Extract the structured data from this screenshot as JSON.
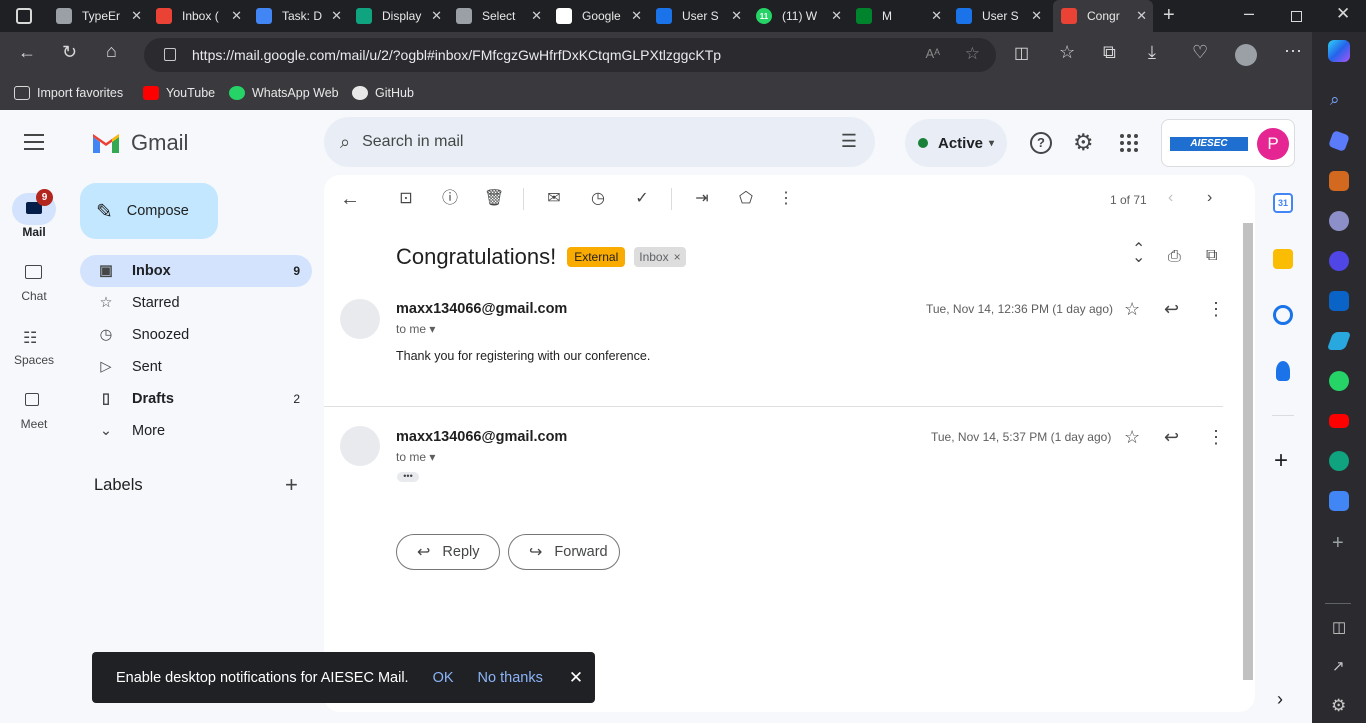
{
  "browser": {
    "tabs": [
      {
        "title": "TypeEr",
        "favicon": "doc-icon",
        "color": "#9aa0a6"
      },
      {
        "title": "Inbox (",
        "favicon": "gmail-icon",
        "color": "#ea4335"
      },
      {
        "title": "Task: D",
        "favicon": "docs-icon",
        "color": "#4285f4"
      },
      {
        "title": "Display",
        "favicon": "chatgpt-icon",
        "color": "#10a37f"
      },
      {
        "title": "Select ",
        "favicon": "doc-icon",
        "color": "#9aa0a6"
      },
      {
        "title": "Google",
        "favicon": "google-icon",
        "color": "#ffffff"
      },
      {
        "title": "User S",
        "favicon": "user-s-icon",
        "color": "#1a73e8"
      },
      {
        "title": "(11) W",
        "favicon": "whatsapp-icon",
        "color": "#25d366"
      },
      {
        "title": "M",
        "favicon": "meet-icon",
        "color": "#00832d"
      },
      {
        "title": "User S",
        "favicon": "user-s-icon",
        "color": "#1a73e8"
      },
      {
        "title": "Congr",
        "favicon": "gmail-icon",
        "color": "#ea4335"
      }
    ],
    "url": "https://mail.google.com/mail/u/2/?ogbl#inbox/FMfcgzGwHfrfDxKCtqmGLPXtlzggcKTp",
    "bookmarks": [
      {
        "label": "Import favorites",
        "icon": "import-icon"
      },
      {
        "label": "YouTube",
        "icon": "youtube-icon"
      },
      {
        "label": "WhatsApp Web",
        "icon": "whatsapp-icon"
      },
      {
        "label": "GitHub",
        "icon": "github-icon"
      }
    ],
    "whatsapp_badge": "11"
  },
  "gmail": {
    "brand": "Gmail",
    "compose_label": "Compose",
    "search_placeholder": "Search in mail",
    "status": "Active",
    "org_logo_text": "AIESEC",
    "account_initial": "P",
    "rail": [
      {
        "label": "Mail",
        "badge": "9"
      },
      {
        "label": "Chat"
      },
      {
        "label": "Spaces"
      },
      {
        "label": "Meet"
      }
    ],
    "nav": [
      {
        "label": "Inbox",
        "count": "9"
      },
      {
        "label": "Starred",
        "count": ""
      },
      {
        "label": "Snoozed",
        "count": ""
      },
      {
        "label": "Sent",
        "count": ""
      },
      {
        "label": "Drafts",
        "count": "2"
      },
      {
        "label": "More",
        "count": ""
      }
    ],
    "labels_heading": "Labels",
    "pagination": "1 of 71",
    "subject": "Congratulations!",
    "tags": {
      "external": "External",
      "inbox": "Inbox"
    },
    "messages": [
      {
        "from": "maxx134066@gmail.com",
        "to": "to me",
        "date": "Tue, Nov 14, 12:36 PM (1 day ago)",
        "body": "Thank you for registering with our conference."
      },
      {
        "from": "maxx134066@gmail.com",
        "to": "to me",
        "date": "Tue, Nov 14, 5:37 PM (1 day ago)",
        "body": ""
      }
    ],
    "reply_label": "Reply",
    "forward_label": "Forward",
    "toast": {
      "text": "Enable desktop notifications for AIESEC Mail.",
      "ok": "OK",
      "no_thanks": "No thanks"
    }
  }
}
